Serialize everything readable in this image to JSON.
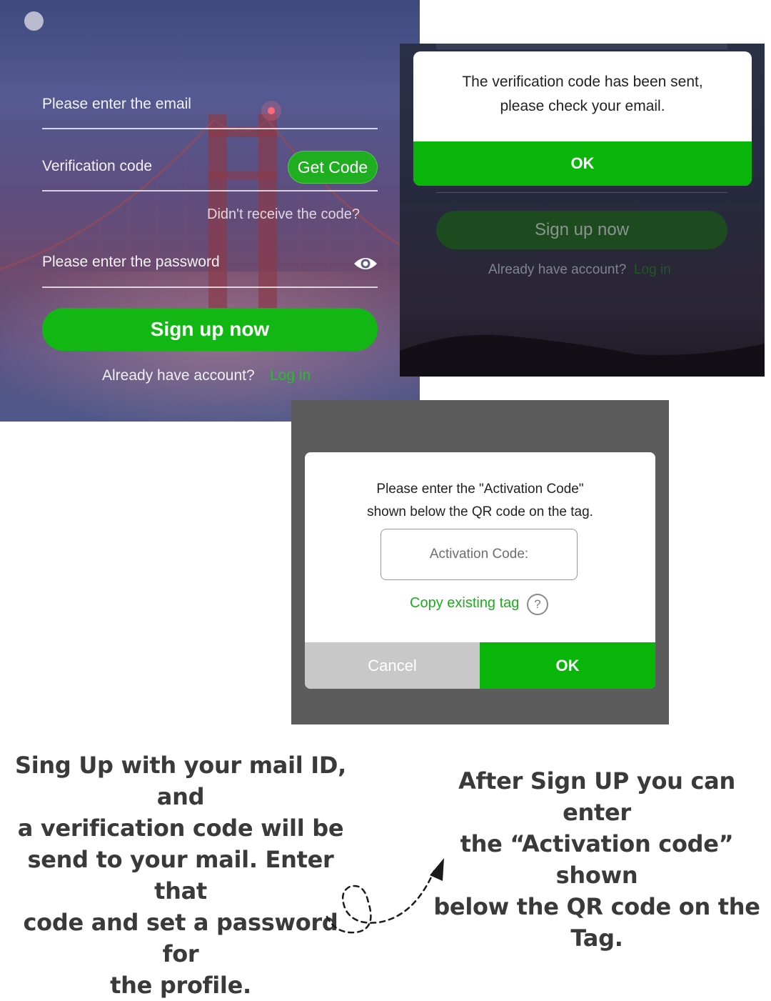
{
  "signup": {
    "email_placeholder": "Please enter the email",
    "code_placeholder": "Verification code",
    "get_code_label": "Get Code",
    "didnt_receive": "Didn't receive the code?",
    "password_placeholder": "Please enter the password",
    "signup_label": "Sign up now",
    "already_text": "Already have account?",
    "login_label": "Log in"
  },
  "verify_dialog": {
    "message_line1": "The verification code has been sent,",
    "message_line2": "please check your email.",
    "ok_label": "OK",
    "background_signup_label": "Sign up now",
    "background_already_text": "Already have account?",
    "background_login_label": "Log in"
  },
  "activation_dialog": {
    "message_line1": "Please enter the \"Activation Code\"",
    "message_line2": "shown below the QR code on the tag.",
    "input_placeholder": "Activation Code:",
    "copy_link_label": "Copy existing tag",
    "help_symbol": "?",
    "cancel_label": "Cancel",
    "ok_label": "OK"
  },
  "captions": {
    "left_line1": "Sing Up with your mail ID, and",
    "left_line2": "a verification code will be",
    "left_line3": "send to your mail. Enter that",
    "left_line4": "code and set a password for",
    "left_line5": "the profile.",
    "right_line1": "After Sign UP you can enter",
    "right_line2": "the “Activation code” shown",
    "right_line3": "below the QR code on the Tag."
  },
  "icons": {
    "eye": "eye-icon",
    "help": "question-circle-icon",
    "arrow": "dashed-curved-arrow-icon"
  },
  "colors": {
    "accent_green": "#08b508",
    "caption_text": "#3a3a3a",
    "modal_overlay": "#5c5c5c"
  }
}
